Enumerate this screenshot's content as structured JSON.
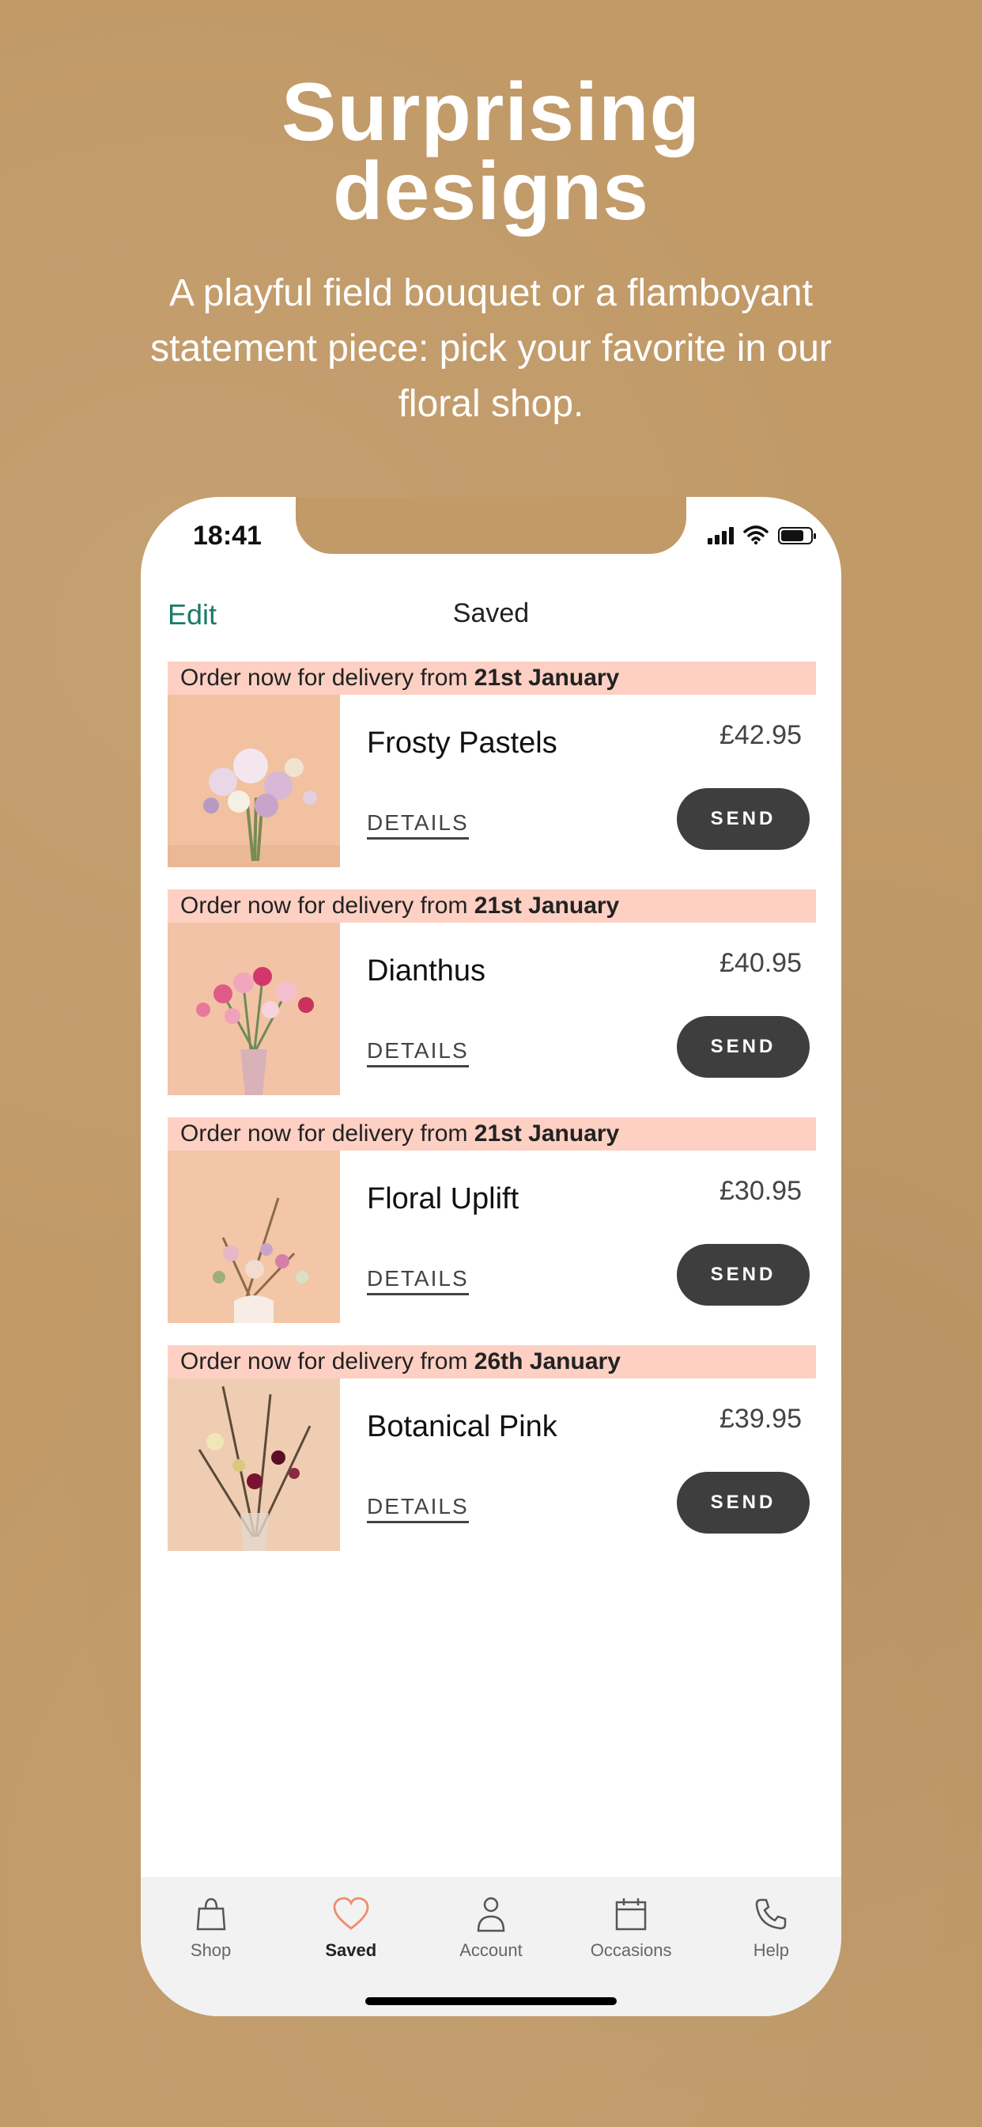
{
  "headline": {
    "line1": "Surprising",
    "line2": "designs"
  },
  "subhead": "A playful field bouquet or a flamboyant statement piece: pick your favorite in our floral shop.",
  "status": {
    "time": "18:41"
  },
  "navbar": {
    "edit": "Edit",
    "title": "Saved"
  },
  "items": [
    {
      "banner_prefix": "Order now for delivery from",
      "banner_date": "21st January",
      "name": "Frosty Pastels",
      "price": "£42.95",
      "details": "DETAILS",
      "send": "SEND",
      "bg": "#f1c1a0"
    },
    {
      "banner_prefix": "Order now for delivery from",
      "banner_date": "21st January",
      "name": "Dianthus",
      "price": "£40.95",
      "details": "DETAILS",
      "send": "SEND",
      "bg": "#f2c3a6"
    },
    {
      "banner_prefix": "Order now for delivery from",
      "banner_date": "21st January",
      "name": "Floral Uplift",
      "price": "£30.95",
      "details": "DETAILS",
      "send": "SEND",
      "bg": "#f3c6a8"
    },
    {
      "banner_prefix": "Order now for delivery from",
      "banner_date": "26th January",
      "name": "Botanical Pink",
      "price": "£39.95",
      "details": "DETAILS",
      "send": "SEND",
      "bg": "#efcdb2"
    }
  ],
  "tabs": [
    {
      "label": "Shop",
      "icon": "bag-icon"
    },
    {
      "label": "Saved",
      "icon": "heart-icon",
      "active": true
    },
    {
      "label": "Account",
      "icon": "person-icon"
    },
    {
      "label": "Occasions",
      "icon": "calendar-icon"
    },
    {
      "label": "Help",
      "icon": "phone-icon"
    }
  ],
  "colors": {
    "background": "#c19a68",
    "accent": "#1c7a6a",
    "banner": "#fdd0c3",
    "send_button": "#3e3e3e",
    "active_tab_icon": "#f08c6e"
  }
}
